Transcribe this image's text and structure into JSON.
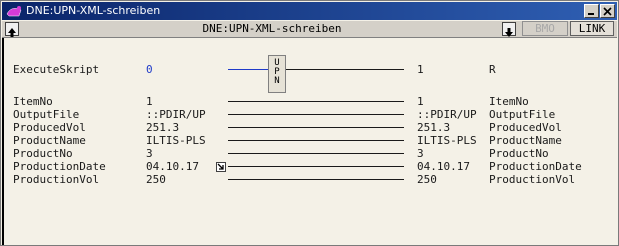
{
  "window": {
    "title": "DNE:UPN-XML-schreiben"
  },
  "toolbar": {
    "center_title": "DNE:UPN-XML-schreiben",
    "bmo_label": "BMO",
    "link_label": "LINK"
  },
  "execute": {
    "label": "ExecuteSkript",
    "left_value": "0",
    "slider_text": [
      "U",
      "P",
      "N"
    ],
    "right_value": "1",
    "right_label": "R"
  },
  "rows": [
    {
      "label": "ItemNo",
      "left_value": "1",
      "right_value": "1",
      "right_label": "ItemNo"
    },
    {
      "label": "OutputFile",
      "left_value": "::PDIR/UP",
      "right_value": "::PDIR/UP",
      "right_label": "OutputFile"
    },
    {
      "label": "ProducedVol",
      "left_value": "251.3",
      "right_value": "251.3",
      "right_label": "ProducedVol"
    },
    {
      "label": "ProductName",
      "left_value": "ILTIS-PLS",
      "right_value": "ILTIS-PLS",
      "right_label": "ProductName"
    },
    {
      "label": "ProductNo",
      "left_value": "3",
      "right_value": "3",
      "right_label": "ProductNo"
    },
    {
      "label": "ProductionDate",
      "left_value": "04.10.17",
      "right_value": "04.10.17",
      "right_label": "ProductionDate"
    },
    {
      "label": "ProductionVol",
      "left_value": "250",
      "right_value": "250",
      "right_label": "ProductionVol"
    }
  ],
  "colors": {
    "title_bar": "#0a2469",
    "value_blue": "#1f3bc9",
    "background": "#f4f1e7"
  }
}
